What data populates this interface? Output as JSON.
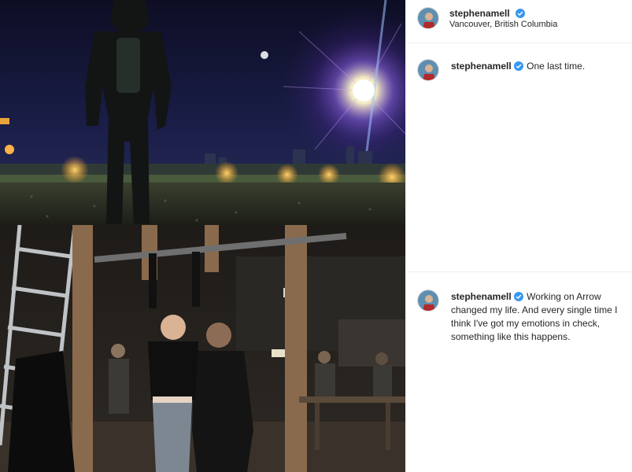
{
  "post_header": {
    "username": "stephenamell",
    "location": "Vancouver, British Columbia",
    "verified_icon": "verified-badge-icon"
  },
  "captions": [
    {
      "username": "stephenamell",
      "text": "One last time."
    },
    {
      "username": "stephenamell",
      "lines": [
        "Working on Arrow",
        "changed my life. And every single time I",
        "think I've got my emotions in check,",
        "something like this happens."
      ]
    }
  ],
  "colors": {
    "verified_blue": "#3897f0",
    "text_dark": "#262626",
    "divider": "#efefef",
    "night_sky": "#10102a",
    "studio_dark": "#1a1a1a"
  }
}
